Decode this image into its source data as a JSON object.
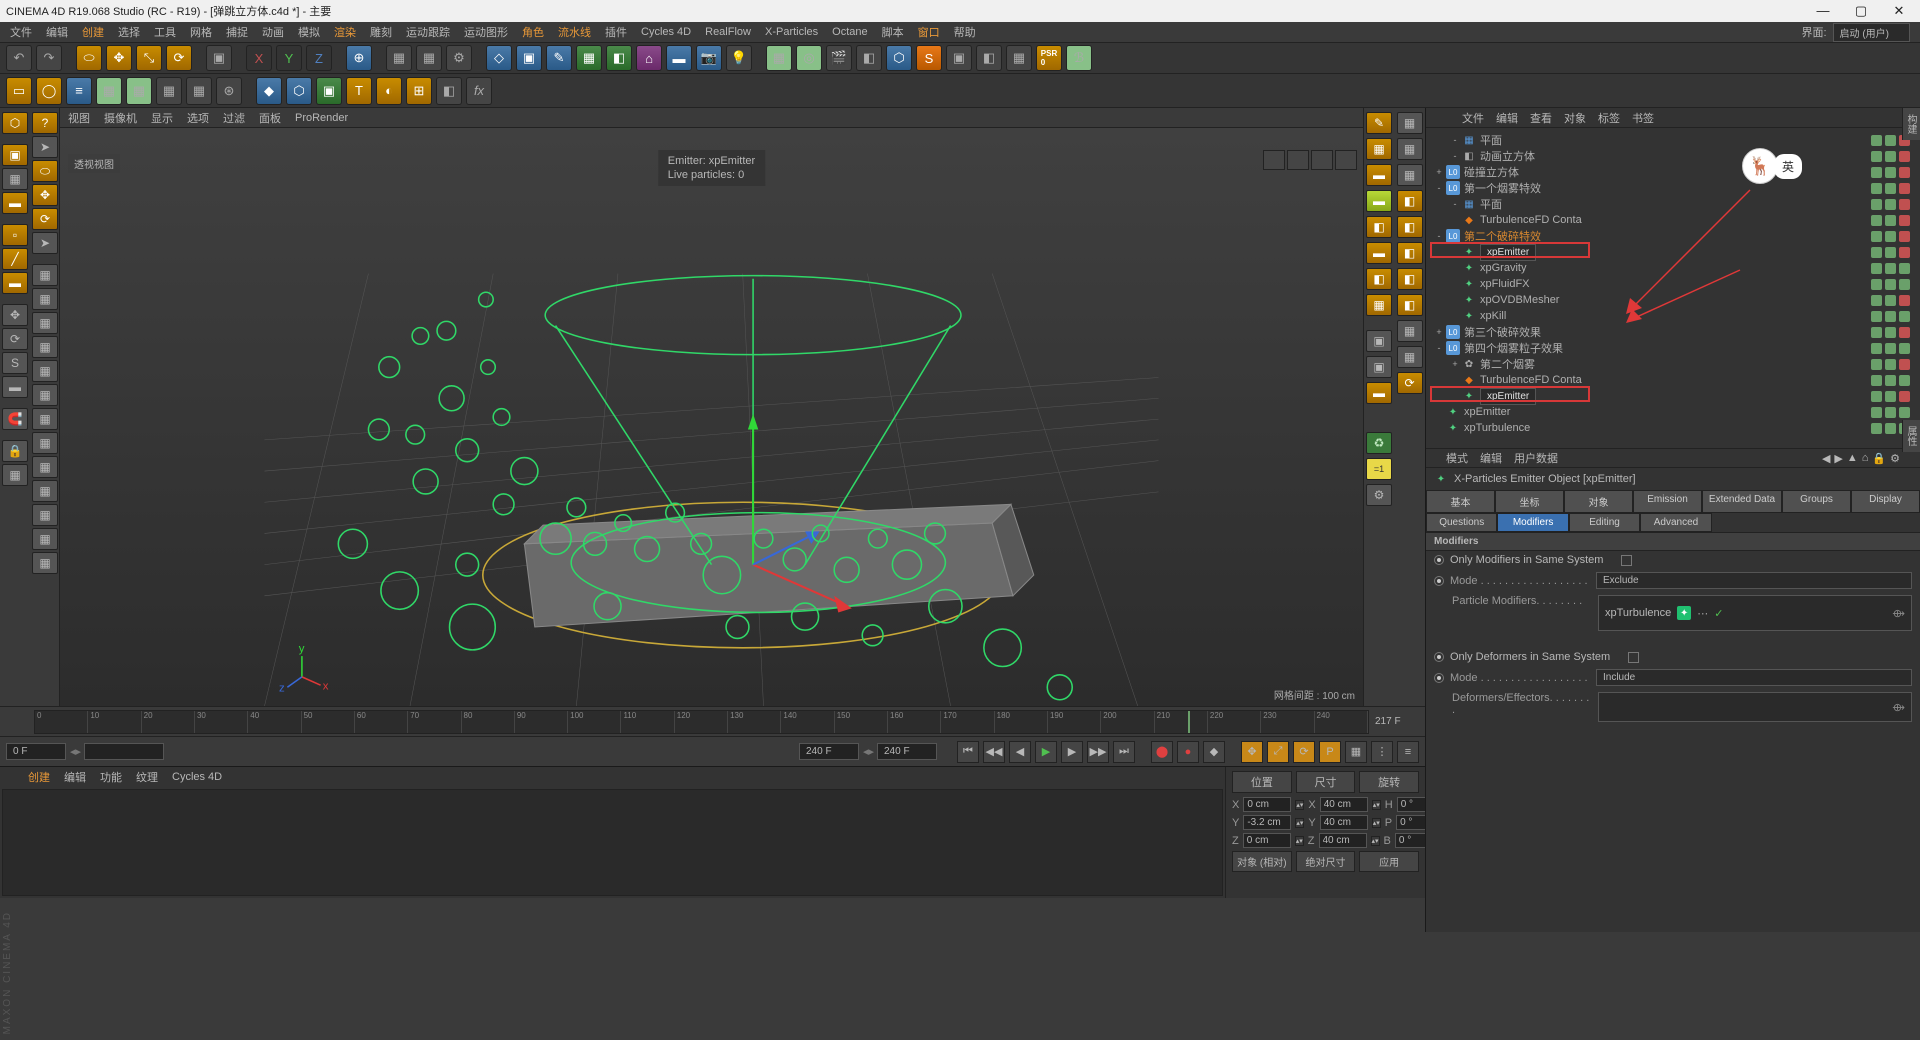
{
  "titlebar": {
    "text": "CINEMA 4D R19.068 Studio (RC - R19) - [弹跳立方体.c4d *] - 主要"
  },
  "menubar": {
    "items": [
      "文件",
      "编辑",
      "创建",
      "选择",
      "工具",
      "网格",
      "捕捉",
      "动画",
      "模拟",
      "渲染",
      "雕刻",
      "运动跟踪",
      "运动图形",
      "角色",
      "流水线",
      "插件",
      "Cycles 4D",
      "RealFlow",
      "X-Particles",
      "Octane",
      "脚本",
      "窗口",
      "帮助"
    ],
    "layout_label": "界面:",
    "layout_value": "启动 (用户)"
  },
  "viewport": {
    "menu": [
      "视图",
      "摄像机",
      "显示",
      "选项",
      "过滤",
      "面板",
      "ProRender"
    ],
    "label": "透视视图",
    "emitter_line": "Emitter: xpEmitter",
    "particles_line": "Live particles: 0",
    "grid_label": "网格间距 : 100 cm"
  },
  "right": {
    "tabs": [
      "文件",
      "编辑",
      "查看",
      "对象",
      "标签",
      "书签"
    ],
    "om": [
      {
        "d": 1,
        "ex": "-",
        "ic": "▦",
        "nm": "平面",
        "c": [
          "g",
          "g",
          "r"
        ]
      },
      {
        "d": 1,
        "ex": "-",
        "ic": "◧",
        "nm": "动画立方体",
        "c": [
          "g",
          "g",
          "r"
        ]
      },
      {
        "d": 0,
        "ex": "+",
        "ic": "L0",
        "nm": "碰撞立方体",
        "c": [
          "g",
          "g",
          "r"
        ]
      },
      {
        "d": 0,
        "ex": "-",
        "ic": "L0",
        "nm": "第一个烟雾特效",
        "c": [
          "g",
          "g",
          "r"
        ]
      },
      {
        "d": 1,
        "ex": "-",
        "ic": "▦",
        "nm": "平面",
        "c": [
          "g",
          "g",
          "r"
        ]
      },
      {
        "d": 1,
        "ex": "",
        "ic": "◆",
        "nm": "TurbulenceFD Conta",
        "c": [
          "g",
          "g",
          "r"
        ]
      },
      {
        "d": 0,
        "ex": "-",
        "ic": "L0",
        "nm": "第二个破碎特效",
        "cls": "or",
        "c": [
          "g",
          "g",
          "r"
        ]
      },
      {
        "d": 1,
        "ex": "",
        "ic": "✦",
        "nm": "xpEmitter",
        "sel": true,
        "c": [
          "g",
          "g",
          "r"
        ],
        "box": 1
      },
      {
        "d": 1,
        "ex": "",
        "ic": "✦",
        "nm": "xpGravity",
        "c": [
          "g",
          "g",
          "g"
        ]
      },
      {
        "d": 1,
        "ex": "",
        "ic": "✦",
        "nm": "xpFluidFX",
        "c": [
          "g",
          "g",
          "g"
        ]
      },
      {
        "d": 1,
        "ex": "",
        "ic": "✦",
        "nm": "xpOVDBMesher",
        "c": [
          "g",
          "g",
          "r"
        ]
      },
      {
        "d": 1,
        "ex": "",
        "ic": "✦",
        "nm": "xpKill",
        "c": [
          "g",
          "g",
          "g"
        ]
      },
      {
        "d": 0,
        "ex": "+",
        "ic": "L0",
        "nm": "第三个破碎效果",
        "c": [
          "g",
          "g",
          "r"
        ]
      },
      {
        "d": 0,
        "ex": "-",
        "ic": "L0",
        "nm": "第四个烟雾粒子效果",
        "c": [
          "g",
          "g",
          "g"
        ]
      },
      {
        "d": 1,
        "ex": "+",
        "ic": "✿",
        "nm": "第二个烟雾",
        "c": [
          "g",
          "g",
          "r"
        ]
      },
      {
        "d": 1,
        "ex": "",
        "ic": "◆",
        "nm": "TurbulenceFD Conta",
        "c": [
          "g",
          "g",
          "g"
        ]
      },
      {
        "d": 1,
        "ex": "",
        "ic": "✦",
        "nm": "xpEmitter",
        "sel": true,
        "c": [
          "g",
          "g",
          "r"
        ],
        "box": 2
      },
      {
        "d": 0,
        "ex": "",
        "ic": "✦",
        "nm": "xpEmitter",
        "c": [
          "g",
          "g",
          "g"
        ]
      },
      {
        "d": 0,
        "ex": "",
        "ic": "✦",
        "nm": "xpTurbulence",
        "c": [
          "g",
          "g",
          "g"
        ]
      }
    ],
    "attr": {
      "menu": [
        "模式",
        "编辑",
        "用户数据"
      ],
      "title": "X-Particles Emitter Object [xpEmitter]",
      "tabs_top": [
        "基本",
        "坐标",
        "对象",
        "Emission",
        "Extended Data",
        "Groups",
        "Display"
      ],
      "tabs_bot": [
        "Questions",
        "Modifiers",
        "Editing",
        "Advanced"
      ],
      "active_tab": "Modifiers",
      "group": "Modifiers",
      "only_mod_label": "Only Modifiers in Same System",
      "mode_label": "Mode",
      "mode_val": "Exclude",
      "pm_label": "Particle Modifiers",
      "pm_val": "xpTurbulence",
      "only_def_label": "Only Deformers in Same System",
      "mode2_label": "Mode",
      "mode2_val": "Include",
      "de_label": "Deformers/Effectors"
    }
  },
  "timeline": {
    "ticks": [
      "0",
      "10",
      "20",
      "30",
      "40",
      "50",
      "60",
      "70",
      "80",
      "90",
      "100",
      "110",
      "120",
      "130",
      "140",
      "150",
      "160",
      "170",
      "180",
      "190",
      "200",
      "210",
      "220",
      "230",
      "240"
    ],
    "cur": "217",
    "end_label": "217 F",
    "f_start": "0 F",
    "f_end": "240 F",
    "f_end2": "240 F"
  },
  "coords": {
    "hdrs": [
      "位置",
      "尺寸",
      "旋转"
    ],
    "rows": [
      {
        "ax": "X",
        "p": "0 cm",
        "s": "40 cm",
        "r": "0 °",
        "sl": "H"
      },
      {
        "ax": "Y",
        "p": "-3.2 cm",
        "s": "40 cm",
        "r": "0 °",
        "sl": "P"
      },
      {
        "ax": "Z",
        "p": "0 cm",
        "s": "40 cm",
        "r": "0 °",
        "sl": "B"
      }
    ],
    "obj_sel": "对象 (相对)",
    "size_sel": "绝对尺寸",
    "apply": "应用"
  },
  "bottom_tabs": [
    "创建",
    "编辑",
    "功能",
    "纹理",
    "Cycles 4D"
  ],
  "ime": {
    "tag": "英"
  },
  "footer": "MAXON CINEMA 4D"
}
